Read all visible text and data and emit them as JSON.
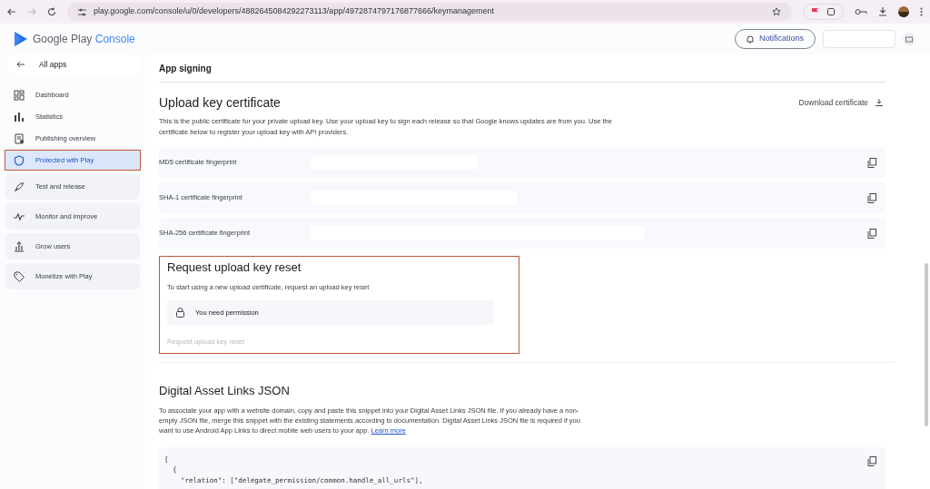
{
  "browser": {
    "url": "play.google.com/console/u/0/developers/4882645084292273113/app/4972874797176877666/keymanagement"
  },
  "header": {
    "logo_text": "Google Play",
    "logo_accent": "Console",
    "notifications": "Notifications"
  },
  "sidebar": {
    "back": "All apps",
    "items": [
      {
        "label": "Dashboard",
        "kind": "link",
        "selected": false,
        "highlighted": false
      },
      {
        "label": "Statistics",
        "kind": "link",
        "selected": false,
        "highlighted": false
      },
      {
        "label": "Publishing overview",
        "kind": "link",
        "selected": false,
        "highlighted": false
      },
      {
        "label": "Protected with Play",
        "kind": "link",
        "selected": true,
        "highlighted": true
      },
      {
        "label": "Test and release",
        "kind": "group",
        "selected": false,
        "highlighted": false
      },
      {
        "label": "Monitor and improve",
        "kind": "group",
        "selected": false,
        "highlighted": false
      },
      {
        "label": "Grow users",
        "kind": "group",
        "selected": false,
        "highlighted": false
      },
      {
        "label": "Monetize with Play",
        "kind": "group",
        "selected": false,
        "highlighted": false
      }
    ]
  },
  "page_title": "App signing",
  "upload_key": {
    "title": "Upload key certificate",
    "download": "Download certificate",
    "description": "This is the public certificate for your private upload key. Use your upload key to sign each release so that Google knows updates are from you. Use the certificate below to register your upload key with API providers.",
    "fingerprints": [
      {
        "label": "MD5 certificate fingerprint"
      },
      {
        "label": "SHA-1 certificate fingerprint"
      },
      {
        "label": "SHA-256 certificate fingerprint"
      }
    ]
  },
  "reset": {
    "title": "Request upload key reset",
    "description": "To start using a new upload certificate, request an upload key reset",
    "permission": "You need permission",
    "button": "Request upload key reset",
    "button_disabled": true,
    "highlighted": true
  },
  "asset_links": {
    "title": "Digital Asset Links JSON",
    "description": "To associate your app with a website domain, copy and paste this snippet into your Digital Asset Links JSON file. If you already have a non-empty JSON file, merge this snippet with the existing statements according to documentation. Digital Asset Links JSON file is required if you want to use Android App Links to direct mobile web users to your app.",
    "link": "Learn more",
    "code": [
      "[",
      "  {",
      "    \"relation\": [\"delegate_permission/common.handle_all_urls\"],"
    ]
  }
}
